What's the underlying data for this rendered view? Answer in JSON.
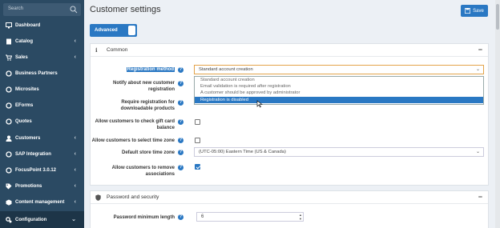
{
  "sidebar": {
    "search_placeholder": "Search",
    "items": [
      {
        "label": "Dashboard",
        "icon": "monitor-icon",
        "chevron": ""
      },
      {
        "label": "Catalog",
        "icon": "book-icon",
        "chevron": "‹"
      },
      {
        "label": "Sales",
        "icon": "cart-icon",
        "chevron": "‹"
      },
      {
        "label": "Business Partners",
        "icon": "circle-icon",
        "chevron": ""
      },
      {
        "label": "Microsites",
        "icon": "circle-icon",
        "chevron": ""
      },
      {
        "label": "EForms",
        "icon": "circle-icon",
        "chevron": ""
      },
      {
        "label": "Quotes",
        "icon": "circle-icon",
        "chevron": ""
      },
      {
        "label": "Customers",
        "icon": "user-icon",
        "chevron": "‹"
      },
      {
        "label": "SAP Integration",
        "icon": "circle-icon",
        "chevron": "‹"
      },
      {
        "label": "FocusPoint 3.0.12",
        "icon": "circle-icon",
        "chevron": "‹"
      },
      {
        "label": "Promotions",
        "icon": "tag-icon",
        "chevron": "‹"
      },
      {
        "label": "Content management",
        "icon": "cube-icon",
        "chevron": "‹"
      },
      {
        "label": "Configuration",
        "icon": "gears-icon",
        "chevron": "⌄"
      }
    ]
  },
  "header": {
    "title": "Customer settings",
    "save_label": "Save",
    "advanced_label": "Advanced"
  },
  "common": {
    "title": "Common",
    "icon": "info-icon",
    "collapse": "−",
    "registration_method_label": "Registration method",
    "registration_method_value": "Standard account creation",
    "registration_options": [
      "Standard account creation",
      "Email validation is required after registration",
      "A customer should be approved by administrator",
      "Registration is disabled"
    ],
    "notify_label_1": "Notify about new customer",
    "notify_label_2": "registration",
    "require_label_1": "Require registration for",
    "require_label_2": "downloadable products",
    "gift_label_1": "Allow customers to check gift card",
    "gift_label_2": "balance",
    "timezone_allow_label": "Allow customers to select time zone",
    "default_tz_label": "Default store time zone",
    "default_tz_value": "(UTC-05:00) Eastern Time (US & Canada)",
    "remove_assoc_label_1": "Allow customers to remove",
    "remove_assoc_label_2": "associations"
  },
  "password": {
    "title": "Password and security",
    "icon": "shield-icon",
    "collapse": "−",
    "min_length_label": "Password minimum length",
    "min_length_value": "6"
  },
  "colors": {
    "sidebar_bg": "#2b4a63",
    "accent": "#2a78c3",
    "focus_border": "#e3a34a"
  }
}
